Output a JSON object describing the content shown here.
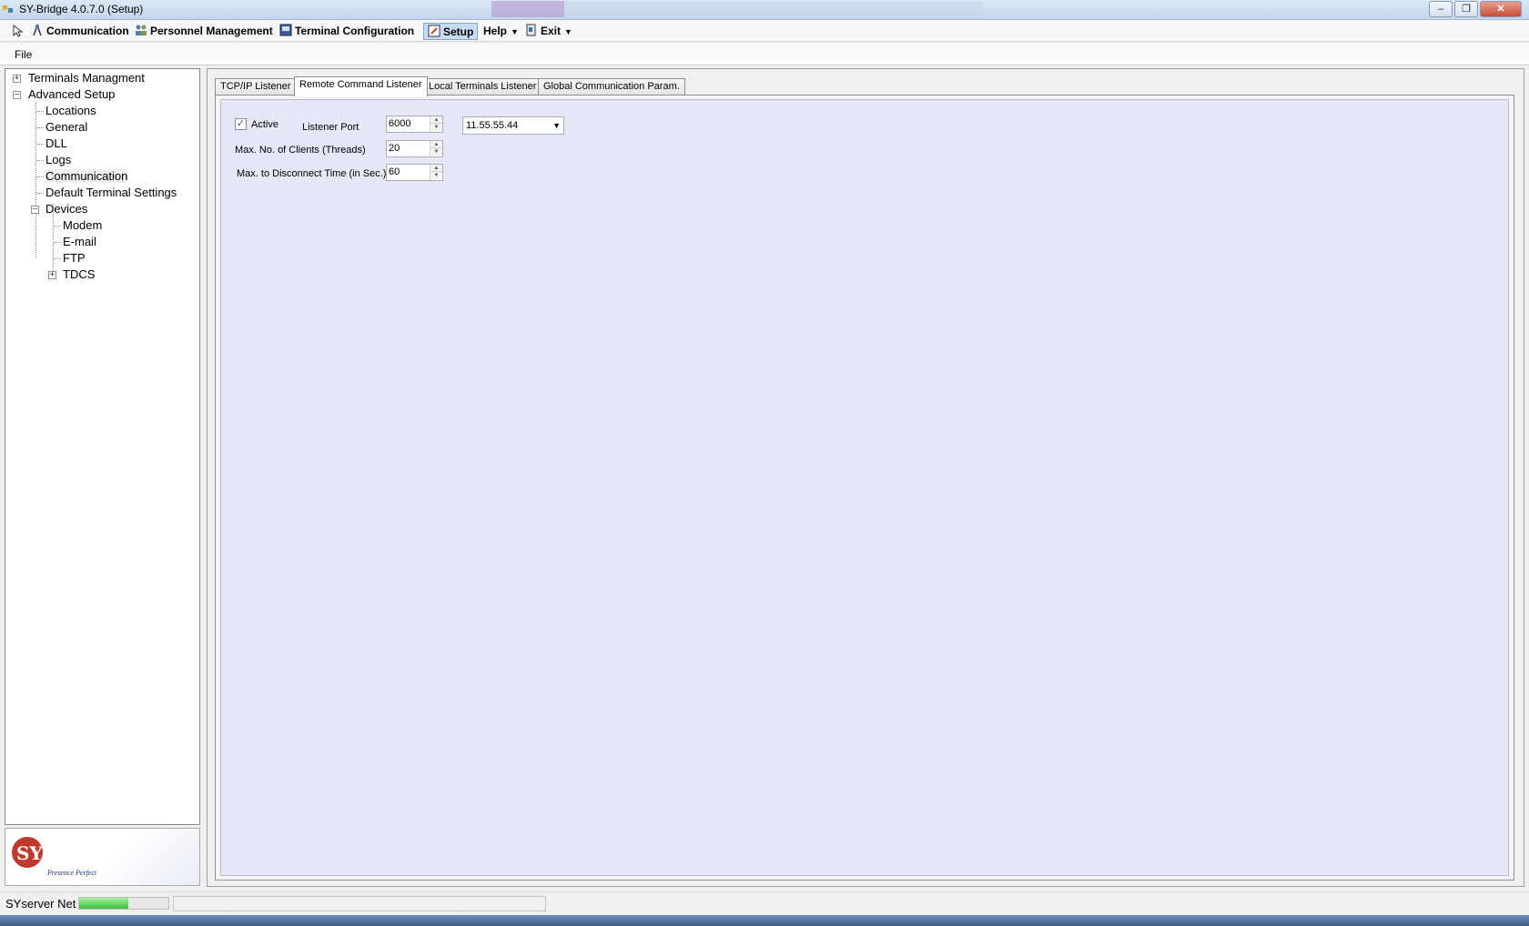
{
  "window": {
    "title": "SY-Bridge  4.0.7.0 (Setup)"
  },
  "toolbar": {
    "communication": "Communication",
    "personnel": "Personnel Management",
    "terminal_config": "Terminal Configuration",
    "setup": "Setup",
    "help": "Help",
    "exit": "Exit"
  },
  "menu": {
    "file": "File"
  },
  "tree": {
    "terminals_managment": "Terminals Managment",
    "advanced_setup": "Advanced Setup",
    "locations": "Locations",
    "general": "General",
    "dll": "DLL",
    "logs": "Logs",
    "communication": "Communication",
    "default_terminal_settings": "Default Terminal Settings",
    "devices": "Devices",
    "modem": "Modem",
    "email": "E-mail",
    "ftp": "FTP",
    "tdcs": "TDCS"
  },
  "tabs": {
    "tcpip": "TCP/IP Listener",
    "remote_command": "Remote Command Listener",
    "local_terminals": "Local Terminals Listener",
    "global_comm": "Global Communication Param."
  },
  "form": {
    "active_label": "Active",
    "listener_port_label": "Listener Port",
    "listener_port_value": "6000",
    "ip_value": "11.55.55.44",
    "max_clients_label": "Max. No. of Clients (Threads)",
    "max_clients_value": "20",
    "max_disconnect_label": "Max. to Disconnect Time (in Sec.)",
    "max_disconnect_value": "60"
  },
  "logo": {
    "text": "SYNEL",
    "tagline": "Presence Perfect"
  },
  "status": {
    "name": "SYserver Net",
    "progress": 0.55
  },
  "colors": {
    "tab_panel_bg": "#e6e8f7",
    "logo_red": "#c0392b",
    "logo_navy": "#1f2e6e"
  }
}
